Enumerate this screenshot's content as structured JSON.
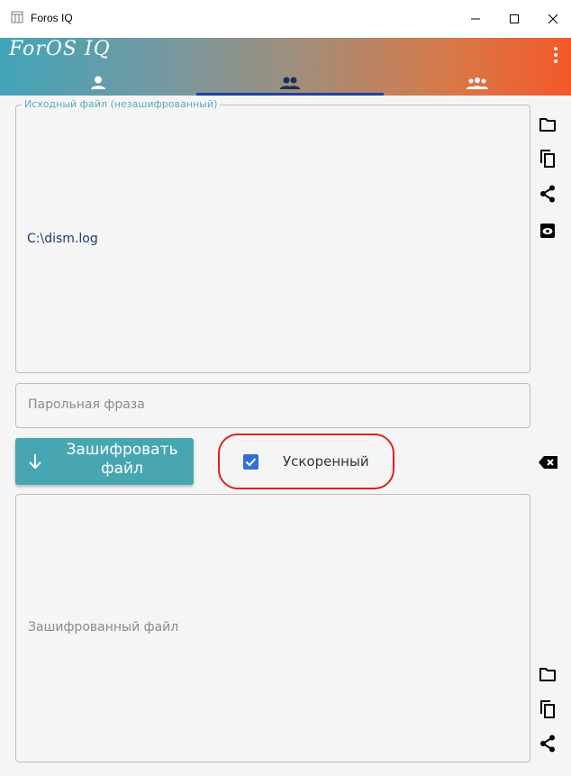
{
  "window": {
    "title": "Foros IQ",
    "controls": {
      "minimize": "minimize-icon",
      "maximize": "maximize-icon",
      "close": "close-icon"
    }
  },
  "appbar": {
    "brand": "ForOS IQ",
    "gradient": [
      "#42a5b8",
      "#f4582a"
    ],
    "menu_icon": "more-vertical-icon"
  },
  "tabs": [
    {
      "icon": "single-user-icon",
      "active": false
    },
    {
      "icon": "two-users-icon",
      "active": true
    },
    {
      "icon": "user-group-icon",
      "active": false
    }
  ],
  "source": {
    "legend": "Исходный файл (незашифрованный)",
    "value": "C:\\dism.log",
    "actions": [
      "folder-icon",
      "copy-icon",
      "share-icon",
      "preview-icon"
    ]
  },
  "passphrase": {
    "placeholder": "Парольная фраза"
  },
  "encrypt": {
    "label": "Зашифровать файл",
    "icon": "arrow-down-icon"
  },
  "fast_mode": {
    "label": "Ускоренный",
    "checked": true
  },
  "clear_icon": "backspace-icon",
  "output": {
    "placeholder": "Зашифрованный файл",
    "actions": [
      "folder-icon",
      "copy-icon",
      "share-icon"
    ]
  },
  "colors": {
    "accent": "#48a6b3",
    "checkbox": "#2f6fd6",
    "tab_indicator": "#1b3fa8",
    "annotation": "#e02020"
  }
}
